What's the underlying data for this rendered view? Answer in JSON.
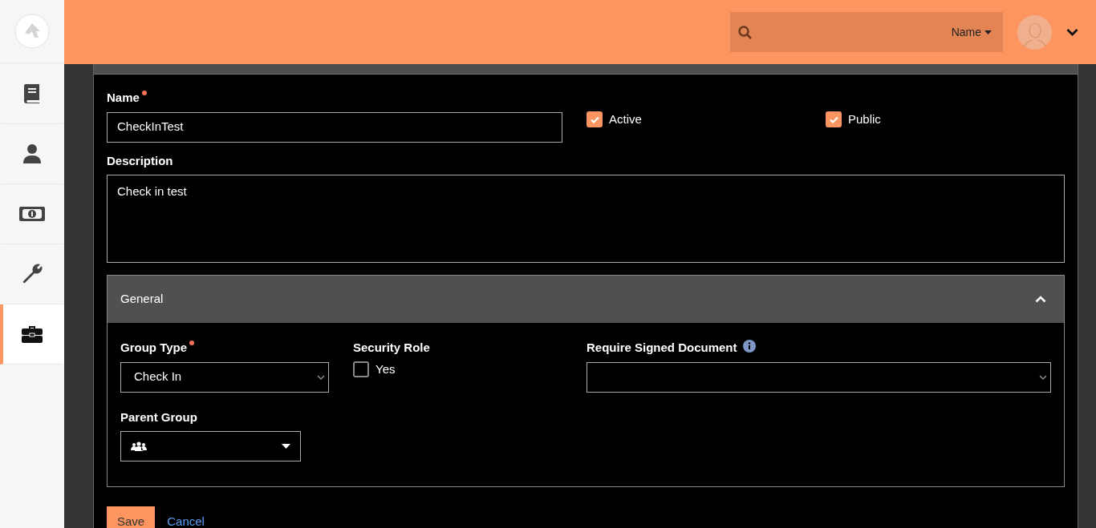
{
  "sidebar": {
    "items": [
      {
        "kind": "book",
        "selected": false
      },
      {
        "kind": "person",
        "selected": false
      },
      {
        "kind": "money",
        "selected": false
      },
      {
        "kind": "wrench",
        "selected": false
      },
      {
        "kind": "briefcase",
        "selected": true
      }
    ]
  },
  "header": {
    "search": {
      "scope": "Name"
    }
  },
  "form": {
    "name": {
      "label": "Name",
      "required": true,
      "value": "CheckInTest"
    },
    "toggles": [
      {
        "label": "Active",
        "checked": true
      },
      {
        "label": "Public",
        "checked": true
      }
    ],
    "description": {
      "label": "Description",
      "value": "Check in test"
    },
    "panel": {
      "title": "General",
      "expanded": true,
      "group_type": {
        "label": "Group Type",
        "required": true,
        "value": "Check In"
      },
      "security_role": {
        "label": "Security Role",
        "option": "Yes",
        "checked": false
      },
      "signed_document": {
        "label": "Require Signed Document"
      },
      "parent_group": {
        "label": "Parent Group"
      }
    }
  },
  "actions": [
    {
      "label": "Save",
      "kind": "primary"
    },
    {
      "label": "Cancel",
      "kind": "link"
    }
  ]
}
